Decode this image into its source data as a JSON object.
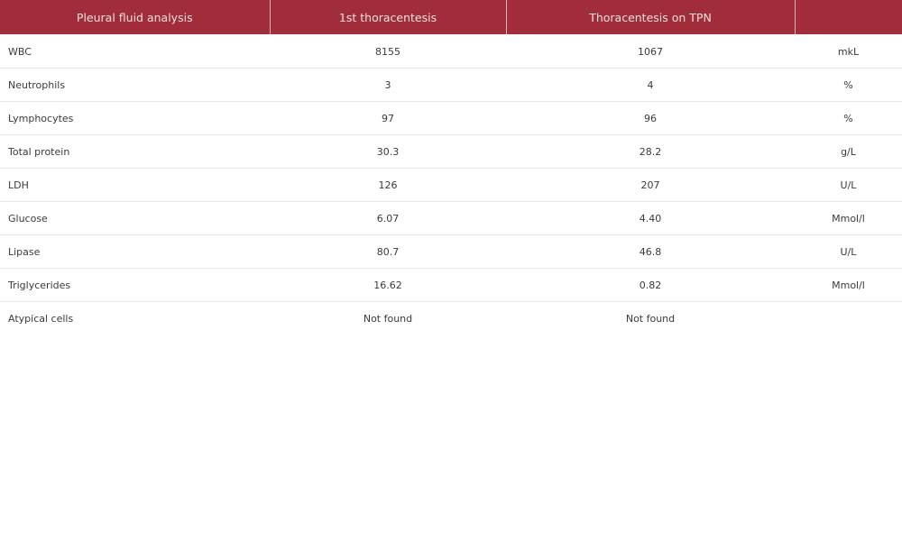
{
  "table": {
    "headers": [
      "Pleural fluid analysis",
      "1st thoracentesis",
      "Thoracentesis on TPN",
      ""
    ],
    "rows": [
      {
        "parameter": "WBC",
        "first": "8155",
        "tpn": "1067",
        "unit": "mkL"
      },
      {
        "parameter": "Neutrophils",
        "first": "3",
        "tpn": "4",
        "unit": "%"
      },
      {
        "parameter": "Lymphocytes",
        "first": "97",
        "tpn": "96",
        "unit": "%"
      },
      {
        "parameter": "Total protein",
        "first": "30.3",
        "tpn": "28.2",
        "unit": "g/L"
      },
      {
        "parameter": "LDH",
        "first": "126",
        "tpn": "207",
        "unit": "U/L"
      },
      {
        "parameter": "Glucose",
        "first": "6.07",
        "tpn": "4.40",
        "unit": "Mmol/l"
      },
      {
        "parameter": "Lipase",
        "first": "80.7",
        "tpn": "46.8",
        "unit": "U/L"
      },
      {
        "parameter": "Triglycerides",
        "first": "16.62",
        "tpn": "0.82",
        "unit": "Mmol/l"
      },
      {
        "parameter": "Atypical cells",
        "first": "Not found",
        "tpn": "Not found",
        "unit": ""
      }
    ]
  },
  "colors": {
    "header_background": "#a12d3b",
    "header_text": "#f3dfe2",
    "row_divider": "#e6e6e6"
  }
}
